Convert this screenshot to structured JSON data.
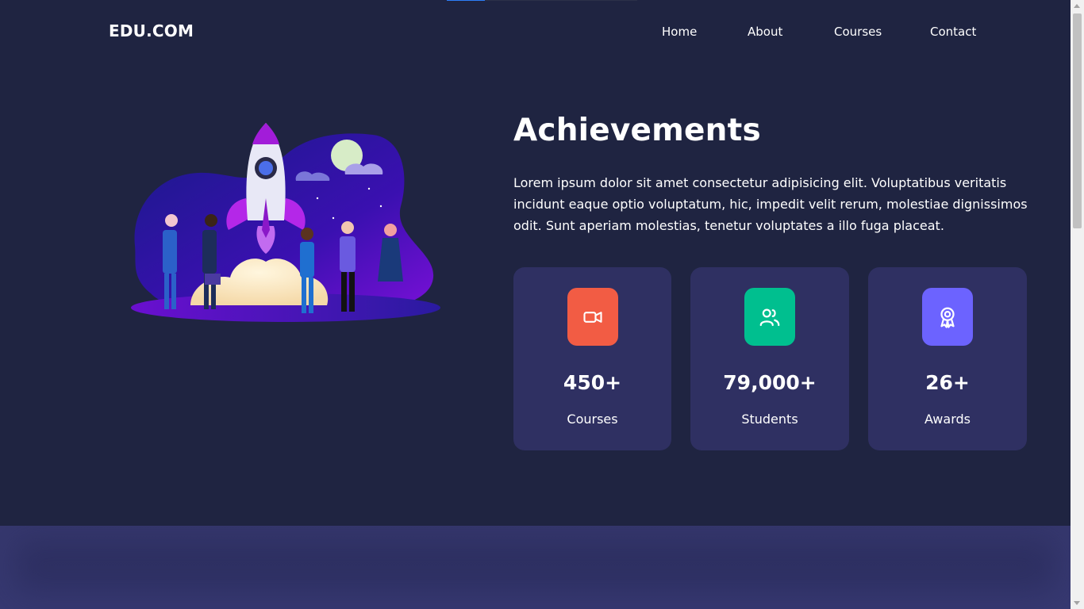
{
  "progress": {
    "fraction": 0.2
  },
  "header": {
    "logo": "EDU.COM",
    "nav": [
      {
        "label": "Home"
      },
      {
        "label": "About"
      },
      {
        "label": "Courses"
      },
      {
        "label": "Contact"
      }
    ]
  },
  "achievements": {
    "title": "Achievements",
    "description": "Lorem ipsum dolor sit amet consectetur adipisicing elit. Voluptatibus veritatis incidunt eaque optio voluptatum, hic, impedit velit rerum, molestiae dignissimos odit. Sunt aperiam molestias, tenetur voluptates a illo fuga placeat.",
    "illustration_icon": "rocket-launch-team-illustration",
    "stats": [
      {
        "value": "450+",
        "label": "Courses",
        "icon": "video-camera-icon",
        "color": "#f25c44"
      },
      {
        "value": "79,000+",
        "label": "Students",
        "icon": "users-icon",
        "color": "#00bf8f"
      },
      {
        "value": "26+",
        "label": "Awards",
        "icon": "award-icon",
        "color": "#6c63ff"
      }
    ]
  },
  "colors": {
    "background": "#1f2441",
    "card": "#2f3062",
    "accent": "#2d7ff9"
  }
}
